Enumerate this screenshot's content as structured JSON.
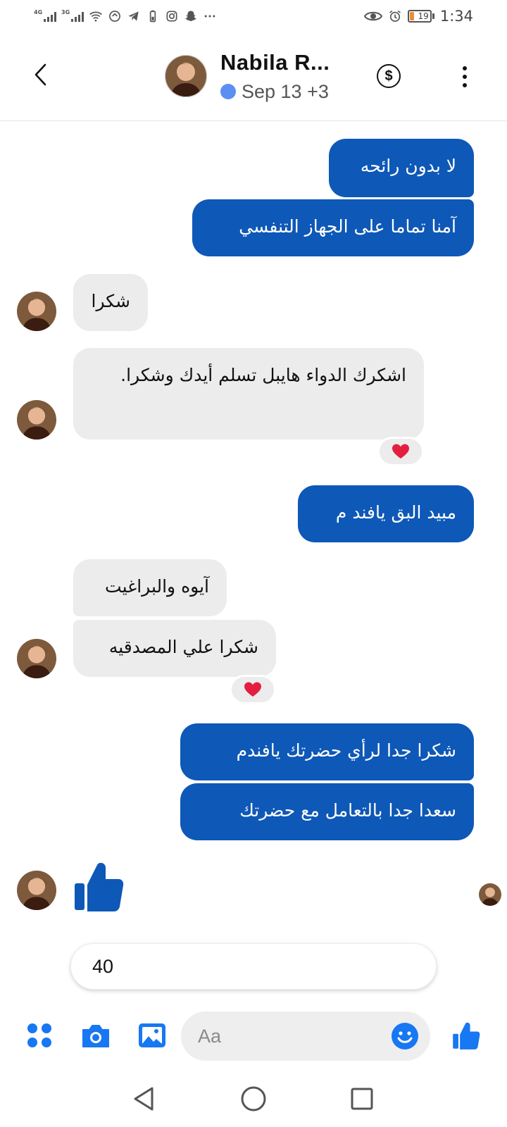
{
  "status_bar": {
    "network_1": "4G",
    "network_2": "3G",
    "battery_level": "19",
    "time": "1:34",
    "icons": [
      "signal-icon",
      "signal-icon",
      "wifi-icon",
      "data-saver-icon",
      "telegram-icon",
      "battery-saver-icon",
      "instagram-icon",
      "snapchat-icon",
      "more-notifications-icon",
      "eye-comfort-icon",
      "alarm-icon",
      "battery-icon"
    ]
  },
  "header": {
    "contact_name": "Nabila R...",
    "presence_text": "Sep 13 +3",
    "presence_color": "#5c8ff2",
    "back_icon": "chevron-left-icon",
    "payment_icon": "dollar-circle-icon",
    "menu_icon": "more-vertical-icon"
  },
  "messages": [
    {
      "direction": "outgoing",
      "text": "لا بدون رائحه"
    },
    {
      "direction": "outgoing",
      "text": "آمنا تماما على الجهاز التنفسي"
    },
    {
      "direction": "incoming",
      "text": "شكرا"
    },
    {
      "direction": "incoming",
      "text": "اشكرك الدواء هايبل تسلم أيدك وشكرا.",
      "reaction": "heart"
    },
    {
      "direction": "outgoing",
      "text": "مبيد البق يافند م"
    },
    {
      "direction": "incoming",
      "text": "آيوه والبراغيت"
    },
    {
      "direction": "incoming",
      "text": "شكرا علي المصدقيه",
      "reaction": "heart"
    },
    {
      "direction": "outgoing",
      "text": "شكرا جدا لرأي حضرتك يافندم"
    },
    {
      "direction": "outgoing",
      "text": "سعدا جدا بالتعامل مع حضرتك"
    },
    {
      "direction": "incoming",
      "type": "like",
      "icon": "thumbs-up-icon"
    }
  ],
  "draft": {
    "text": "40"
  },
  "composer": {
    "placeholder": "Aa",
    "icons": [
      "grid-dots-icon",
      "camera-icon",
      "gallery-icon",
      "emoji-icon",
      "thumbs-up-icon"
    ]
  },
  "nav_bar": {
    "icons": [
      "back-triangle-icon",
      "home-circle-icon",
      "recents-square-icon"
    ]
  },
  "colors": {
    "accent": "#0e58b7",
    "outgoing_bubble": "#0e58b7",
    "incoming_bubble": "#ececec",
    "heart": "#e41e3f",
    "icon_blue": "#1877f2"
  }
}
